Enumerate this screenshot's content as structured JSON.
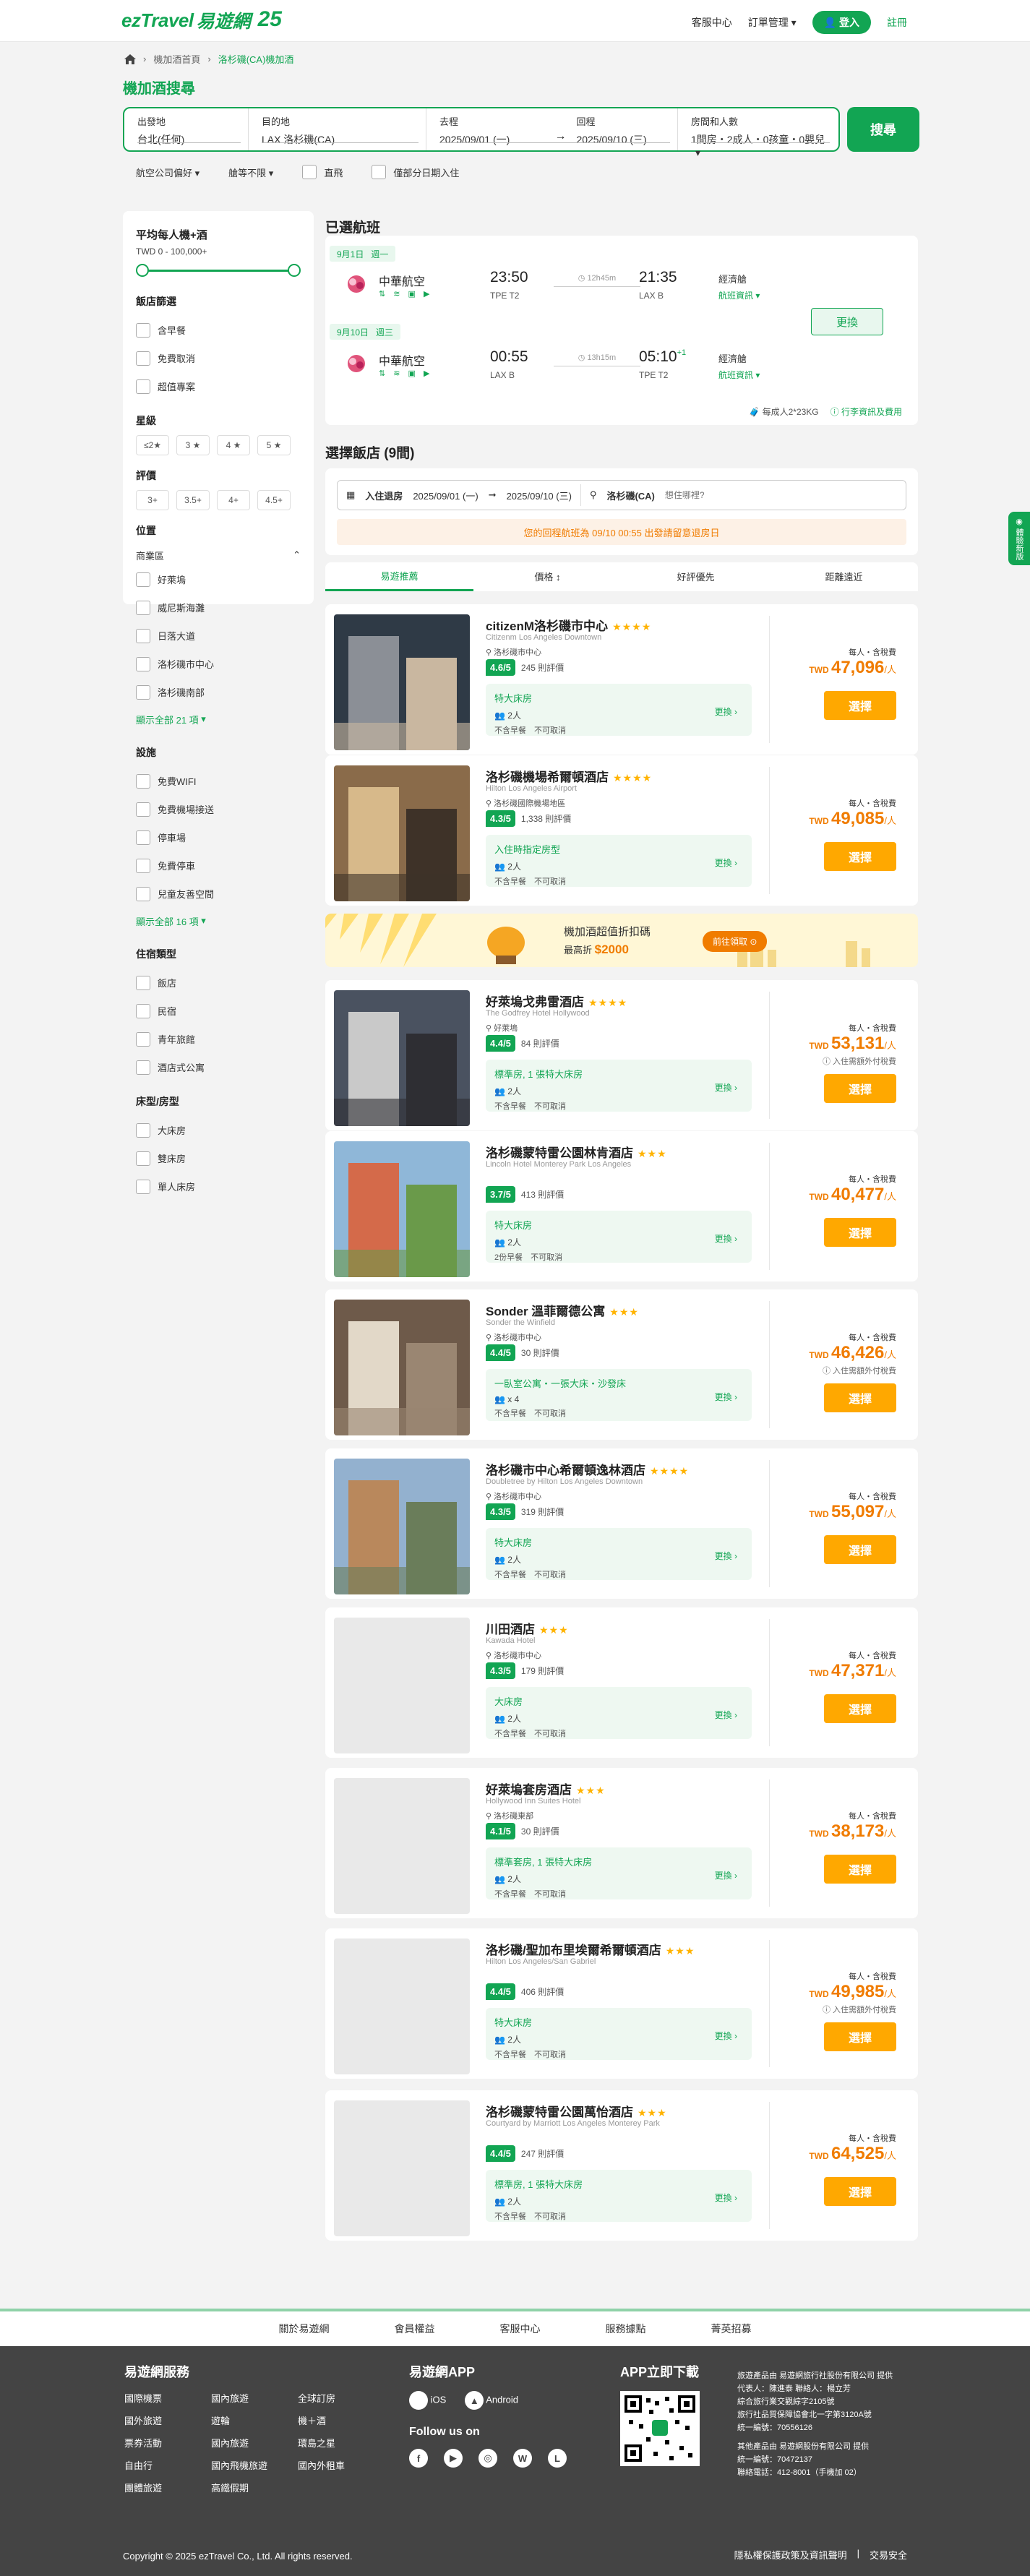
{
  "header": {
    "logo_text": "ezTravel",
    "logo_cn": "易遊網",
    "logo_anniv": "25",
    "nav": [
      "客服中心",
      "訂單管理 ▾"
    ],
    "login": "登入",
    "register": "註冊"
  },
  "breadcrumb": [
    "機加酒首頁",
    "洛杉磯(CA)機加酒"
  ],
  "page_title": "機加酒搜尋",
  "search": {
    "from_label": "出發地",
    "from_value": "台北(任何)",
    "to_label": "目的地",
    "to_value": "LAX 洛杉磯(CA)",
    "depart_label": "去程",
    "depart_value": "2025/09/01 (一)",
    "return_label": "回程",
    "return_value": "2025/09/10 (三)",
    "pax_label": "房間和人數",
    "pax_value": "1間房・2成人・0孩童・0嬰兒",
    "button": "搜尋"
  },
  "options": {
    "airline_pref": "航空公司偏好",
    "cabin": "艙等不限",
    "direct": "直飛",
    "partial_stay": "僅部分日期入住"
  },
  "sidebar": {
    "price_title": "平均每人機+酒",
    "price_range": "TWD 0 - 100,000+",
    "filter_title": "飯店篩選",
    "filters": [
      "含早餐",
      "免費取消",
      "超值專案"
    ],
    "star_title": "星級",
    "stars": [
      "≤2★",
      "3 ★",
      "4 ★",
      "5 ★"
    ],
    "rating_title": "評價",
    "ratings": [
      "3+",
      "3.5+",
      "4+",
      "4.5+"
    ],
    "location_title": "位置",
    "location_group": "商業區",
    "locations": [
      "好萊塢",
      "威尼斯海灘",
      "日落大道",
      "洛杉磯市中心",
      "洛杉磯南部"
    ],
    "location_more": "顯示全部 21 項",
    "facility_title": "設施",
    "facilities": [
      "免費WIFI",
      "免費機場接送",
      "停車場",
      "免費停車",
      "兒童友善空間"
    ],
    "facility_more": "顯示全部 16 項",
    "type_title": "住宿類型",
    "types": [
      "飯店",
      "民宿",
      "青年旅館",
      "酒店式公寓"
    ],
    "bed_title": "床型/房型",
    "beds": [
      "大床房",
      "雙床房",
      "單人床房"
    ]
  },
  "flights": {
    "title": "已選航班",
    "legs": [
      {
        "tag_date": "9月1日",
        "tag_day": "週一",
        "airline": "中華航空",
        "dep_time": "23:50",
        "dep_code": "TPE T2",
        "duration": "12h45m",
        "arr_time": "21:35",
        "arr_plus": "",
        "arr_code": "LAX B",
        "stops": "經濟艙",
        "info": "航班資訊 ▾"
      },
      {
        "tag_date": "9月10日",
        "tag_day": "週三",
        "airline": "中華航空",
        "dep_time": "00:55",
        "dep_code": "LAX B",
        "duration": "13h15m",
        "arr_time": "05:10",
        "arr_plus": "+1",
        "arr_code": "TPE T2",
        "stops": "經濟艙",
        "info": "航班資訊 ▾"
      }
    ],
    "change": "更換",
    "baggage": "每成人2*23KG",
    "rules": "行李資訊及費用"
  },
  "hotel_section": {
    "title": "選擇飯店 (9間)",
    "checkin_label": "入住退房",
    "checkin": "2025/09/01 (一)",
    "checkout": "2025/09/10 (三)",
    "city": "洛杉磯(CA)",
    "keyword_placeholder": "想住哪裡?",
    "note": "您的回程航班為 09/10 00:55 出發請留意退房日",
    "tabs": [
      "易遊推薦",
      "價格 ↕",
      "好評優先",
      "距離遠近"
    ]
  },
  "hotels": [
    {
      "name": "citizenM洛杉磯市中心",
      "stars": "★★★★",
      "en": "Citizenm Los Angeles Downtown",
      "loc": "洛杉磯市中心",
      "score": "4.6/5",
      "reviews": "245 則評價",
      "room": "特大床房",
      "pp": "2人",
      "terms": "不含早餐　不可取消",
      "change": "更換 ›",
      "tax": "每人・含稅費",
      "price": "47,096",
      "note": "",
      "select": "選擇"
    },
    {
      "name": "洛杉磯機場希爾頓酒店",
      "stars": "★★★★",
      "en": "Hilton Los Angeles Airport",
      "loc": "洛杉磯國際機場地區",
      "score": "4.3/5",
      "reviews": "1,338 則評價",
      "room": "入住時指定房型",
      "pp": "2人",
      "terms": "不含早餐　不可取消",
      "change": "更換 ›",
      "tax": "每人・含稅費",
      "price": "49,085",
      "note": "",
      "select": "選擇"
    },
    {
      "name": "好萊塢戈弗雷酒店",
      "stars": "★★★★",
      "en": "The Godfrey Hotel Hollywood",
      "loc": "好萊塢",
      "score": "4.4/5",
      "reviews": "84 則評價",
      "room": "標準房, 1 張特大床房",
      "pp": "2人",
      "terms": "不含早餐　不可取消",
      "change": "更換 ›",
      "tax": "每人・含稅費",
      "price": "53,131",
      "note": "入住需額外付稅費",
      "select": "選擇"
    },
    {
      "name": "洛杉磯蒙特雷公園林肯酒店",
      "stars": "★★★",
      "en": "Lincoln Hotel Monterey Park Los Angeles",
      "loc": "",
      "score": "3.7/5",
      "reviews": "413 則評價",
      "room": "特大床房",
      "pp": "2人",
      "terms": "2份早餐　不可取消",
      "change": "更換 ›",
      "tax": "每人・含稅費",
      "price": "40,477",
      "note": "",
      "select": "選擇"
    },
    {
      "name": "Sonder 溫菲爾德公寓",
      "stars": "★★★",
      "en": "Sonder the Winfield",
      "loc": "洛杉磯市中心",
      "score": "4.4/5",
      "reviews": "30 則評價",
      "room": "一臥室公寓・一張大床・沙發床",
      "pp": "x 4",
      "terms": "不含早餐　不可取消",
      "change": "更換 ›",
      "tax": "每人・含稅費",
      "price": "46,426",
      "note": "入住需額外付稅費",
      "select": "選擇"
    },
    {
      "name": "洛杉磯市中心希爾頓逸林酒店",
      "stars": "★★★★",
      "en": "Doubletree by Hilton Los Angeles Downtown",
      "loc": "洛杉磯市中心",
      "score": "4.3/5",
      "reviews": "319 則評價",
      "room": "特大床房",
      "pp": "2人",
      "terms": "不含早餐　不可取消",
      "change": "更換 ›",
      "tax": "每人・含稅費",
      "price": "55,097",
      "note": "",
      "select": "選擇"
    },
    {
      "name": "川田酒店",
      "stars": "★★★",
      "en": "Kawada Hotel",
      "loc": "洛杉磯市中心",
      "score": "4.3/5",
      "reviews": "179 則評價",
      "room": "大床房",
      "pp": "2人",
      "terms": "不含早餐　不可取消",
      "change": "更換 ›",
      "tax": "每人・含稅費",
      "price": "47,371",
      "note": "",
      "select": "選擇"
    },
    {
      "name": "好萊塢套房酒店",
      "stars": "★★★",
      "en": "Hollywood Inn Suites Hotel",
      "loc": "洛杉磯東部",
      "score": "4.1/5",
      "reviews": "30 則評價",
      "room": "標準套房, 1 張特大床房",
      "pp": "2人",
      "terms": "不含早餐　不可取消",
      "change": "更換 ›",
      "tax": "每人・含稅費",
      "price": "38,173",
      "note": "",
      "select": "選擇"
    },
    {
      "name": "洛杉磯/聖加布里埃爾希爾頓酒店",
      "stars": "★★★",
      "en": "Hilton Los Angeles/San Gabriel",
      "loc": "",
      "score": "4.4/5",
      "reviews": "406 則評價",
      "room": "特大床房",
      "pp": "2人",
      "terms": "不含早餐　不可取消",
      "change": "更換 ›",
      "tax": "每人・含稅費",
      "price": "49,985",
      "note": "入住需額外付稅費",
      "select": "選擇"
    },
    {
      "name": "洛杉磯蒙特雷公園萬怡酒店",
      "stars": "★★★",
      "en": "Courtyard by Marriott Los Angeles Monterey Park",
      "loc": "",
      "score": "4.4/5",
      "reviews": "247 則評價",
      "room": "標準房, 1 張特大床房",
      "pp": "2人",
      "terms": "不含早餐　不可取消",
      "change": "更換 ›",
      "tax": "每人・含稅費",
      "price": "64,525",
      "note": "",
      "select": "選擇"
    }
  ],
  "banner": {
    "title": "機加酒超值折扣碼",
    "sub_prefix": "最高折",
    "amount": "$2000",
    "cta": "前往領取 ⊙"
  },
  "side_tab": "體驗新版",
  "footer_links": [
    "關於易遊網",
    "會員權益",
    "客服中心",
    "服務據點",
    "菁英招募"
  ],
  "footer": {
    "services_title": "易遊網服務",
    "services": [
      "國際機票",
      "國內旅遊",
      "全球訂房",
      "國外旅遊",
      "遊輪",
      "機＋酒",
      "票券活動",
      "國內旅遊",
      "環島之星",
      "自由行",
      "國內飛機旅遊",
      "國內外租車",
      "團體旅遊",
      "高鐵假期"
    ],
    "app_title": "易遊網APP",
    "ios": "iOS",
    "android": "Android",
    "follow": "Follow us on",
    "download_title": "APP立即下載",
    "company_lines": [
      "旅遊產品由 易遊網旅行社股份有限公司 提供",
      "代表人：陳進泰  聯絡人：楊立芳",
      "綜合旅行業交觀綜字2105號",
      "旅行社品質保障協會北一字第3120A號",
      "統一編號：70556126",
      "其他產品由 易遊網股份有限公司 提供",
      "統一編號：70472137",
      "聯絡電話：412-8001（手機加 02）"
    ],
    "copyright": "Copyright © 2025 ezTravel Co., Ltd. All rights reserved.",
    "policy": "隱私權保護政策及資訊聲明",
    "security": "交易安全"
  },
  "colors": {
    "brand": "#12a553",
    "price": "#f07c00",
    "select": "#ffa800"
  }
}
